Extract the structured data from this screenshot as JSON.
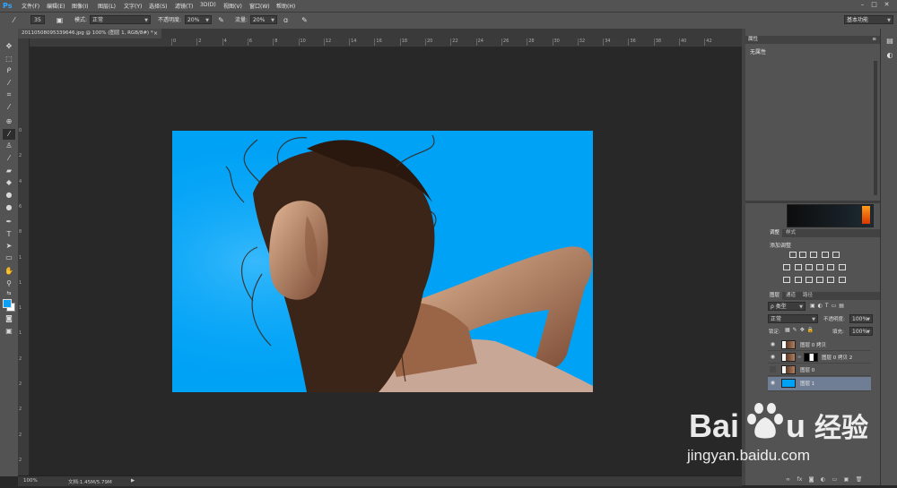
{
  "app": {
    "logo": "Ps"
  },
  "menu": [
    "文件(F)",
    "编辑(E)",
    "图像(I)",
    "图层(L)",
    "文字(Y)",
    "选择(S)",
    "滤镜(T)",
    "3D(D)",
    "视图(V)",
    "窗口(W)",
    "帮助(H)"
  ],
  "window_controls": [
    "–",
    "□",
    "✕"
  ],
  "options": {
    "brush_size": "35",
    "mode_label": "模式:",
    "mode_value": "正常",
    "opacity_label": "不透明度:",
    "opacity_value": "20%",
    "flow_label": "流量:",
    "flow_value": "20%",
    "workspace": "基本功能"
  },
  "document": {
    "tab_title": "20110508095339646.jpg @ 100% (图层 1, RGB/8#) *",
    "close": "×",
    "ruler_ticks": [
      "0",
      "2",
      "4",
      "6",
      "8",
      "10",
      "12",
      "14",
      "16",
      "18",
      "20",
      "22",
      "24",
      "26",
      "28",
      "30",
      "32",
      "34",
      "36",
      "38",
      "40",
      "42"
    ],
    "vruler_ticks": [
      "0",
      "2",
      "4",
      "6",
      "8",
      "1",
      "1",
      "1",
      "1",
      "2",
      "2",
      "2",
      "2",
      "2",
      "3"
    ]
  },
  "status": {
    "zoom": "100%",
    "doc_size": "文档:1.45M/5.79M",
    "arrow": "▶"
  },
  "properties_panel": {
    "title": "属性",
    "no_props": "无属性",
    "menu": "≡"
  },
  "adjustments_panel": {
    "tabs": [
      "调整",
      "样式"
    ],
    "add_label": "添加调整"
  },
  "layers_panel": {
    "tabs": [
      "图层",
      "通道",
      "路径"
    ],
    "filter_kind": "ρ 类型",
    "blend_mode": "正常",
    "opacity_label": "不透明度:",
    "opacity_value": "100%",
    "lock_label": "锁定:",
    "fill_label": "填充:",
    "fill_value": "100%",
    "layers": [
      {
        "name": "图层 0 拷贝",
        "visible": true,
        "selected": false
      },
      {
        "name": "图层 0 拷贝 2",
        "visible": true,
        "selected": false
      },
      {
        "name": "图层 0",
        "visible": false,
        "selected": false
      },
      {
        "name": "图层 1",
        "visible": true,
        "selected": true
      }
    ],
    "bottom_icons": [
      "link-icon",
      "fx-icon",
      "mask-icon",
      "adjustment-icon",
      "folder-icon",
      "new-layer-icon",
      "trash-icon"
    ]
  },
  "watermark": {
    "brand_latin": "Bai",
    "brand_latin_end": "u",
    "brand_cn": "经验",
    "url": "jingyan.baidu.com"
  },
  "colors": {
    "canvas_bg": "#00a2f6",
    "foreground": "#0aa0f5",
    "background": "#ffffff",
    "selected_layer": "#6f7e94"
  }
}
